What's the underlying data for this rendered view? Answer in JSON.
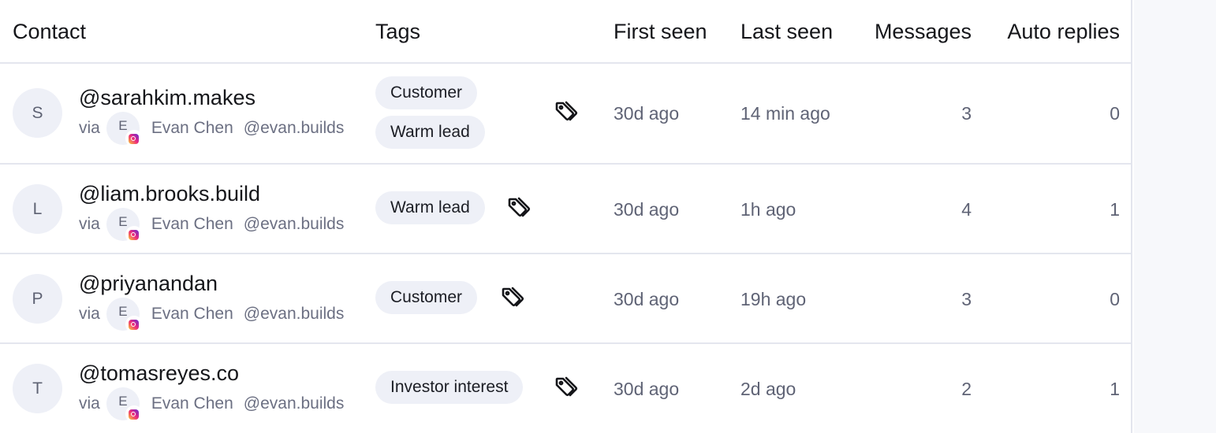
{
  "columns": {
    "contact": "Contact",
    "tags": "Tags",
    "first_seen": "First seen",
    "last_seen": "Last seen",
    "messages": "Messages",
    "auto_replies": "Auto replies"
  },
  "via_label": "via",
  "rows": [
    {
      "avatar_letter": "S",
      "handle": "@sarahkim.makes",
      "account": {
        "avatar_letter": "E",
        "name": "Evan Chen",
        "handle": "@evan.builds",
        "platform_icon": "instagram-icon"
      },
      "tags": [
        "Customer",
        "Warm lead"
      ],
      "first_seen": "30d ago",
      "last_seen": "14 min ago",
      "messages": "3",
      "auto_replies": "0"
    },
    {
      "avatar_letter": "L",
      "handle": "@liam.brooks.build",
      "account": {
        "avatar_letter": "E",
        "name": "Evan Chen",
        "handle": "@evan.builds",
        "platform_icon": "instagram-icon"
      },
      "tags": [
        "Warm lead"
      ],
      "first_seen": "30d ago",
      "last_seen": "1h ago",
      "messages": "4",
      "auto_replies": "1"
    },
    {
      "avatar_letter": "P",
      "handle": "@priyanandan",
      "account": {
        "avatar_letter": "E",
        "name": "Evan Chen",
        "handle": "@evan.builds",
        "platform_icon": "instagram-icon"
      },
      "tags": [
        "Customer"
      ],
      "first_seen": "30d ago",
      "last_seen": "19h ago",
      "messages": "3",
      "auto_replies": "0"
    },
    {
      "avatar_letter": "T",
      "handle": "@tomasreyes.co",
      "account": {
        "avatar_letter": "E",
        "name": "Evan Chen",
        "handle": "@evan.builds",
        "platform_icon": "instagram-icon"
      },
      "tags": [
        "Investor interest"
      ],
      "first_seen": "30d ago",
      "last_seen": "2d ago",
      "messages": "2",
      "auto_replies": "1"
    }
  ],
  "icons": {
    "edit_tags": "tag-icon"
  }
}
